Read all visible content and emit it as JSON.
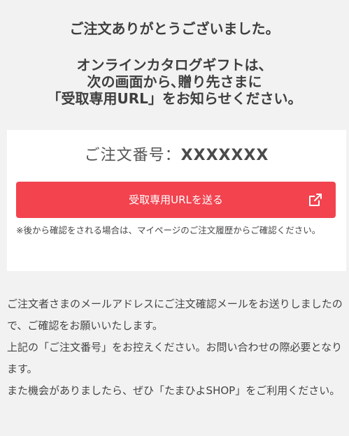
{
  "header": {
    "thanks": "ご注文ありがとうございました。",
    "instruction_lines": [
      "オンラインカタログギフトは、",
      "次の画面から､贈り先さまに",
      "「受取専用URL」をお知らせください。"
    ]
  },
  "order": {
    "label": "ご注文番号：",
    "value": "XXXXXXX"
  },
  "send_button": {
    "label": "受取専用URLを送る",
    "icon": "external-link-icon"
  },
  "note": "※後から確認をされる場合は、マイページのご注文履歴からご確認ください。",
  "body_paragraphs": [
    "ご注文者さまのメールアドレスにご注文確認メールをお送りしましたので、ご確認をお願いいたします。",
    "上記の「ご注文番号」をお控えください。お問い合わせの際必要となります。",
    "また機会がありましたら、ぜひ「たまひよSHOP」をご利用ください。"
  ],
  "colors": {
    "background": "#f2f2f2",
    "card": "#ffffff",
    "button": "#f2434f",
    "text": "#444444"
  }
}
